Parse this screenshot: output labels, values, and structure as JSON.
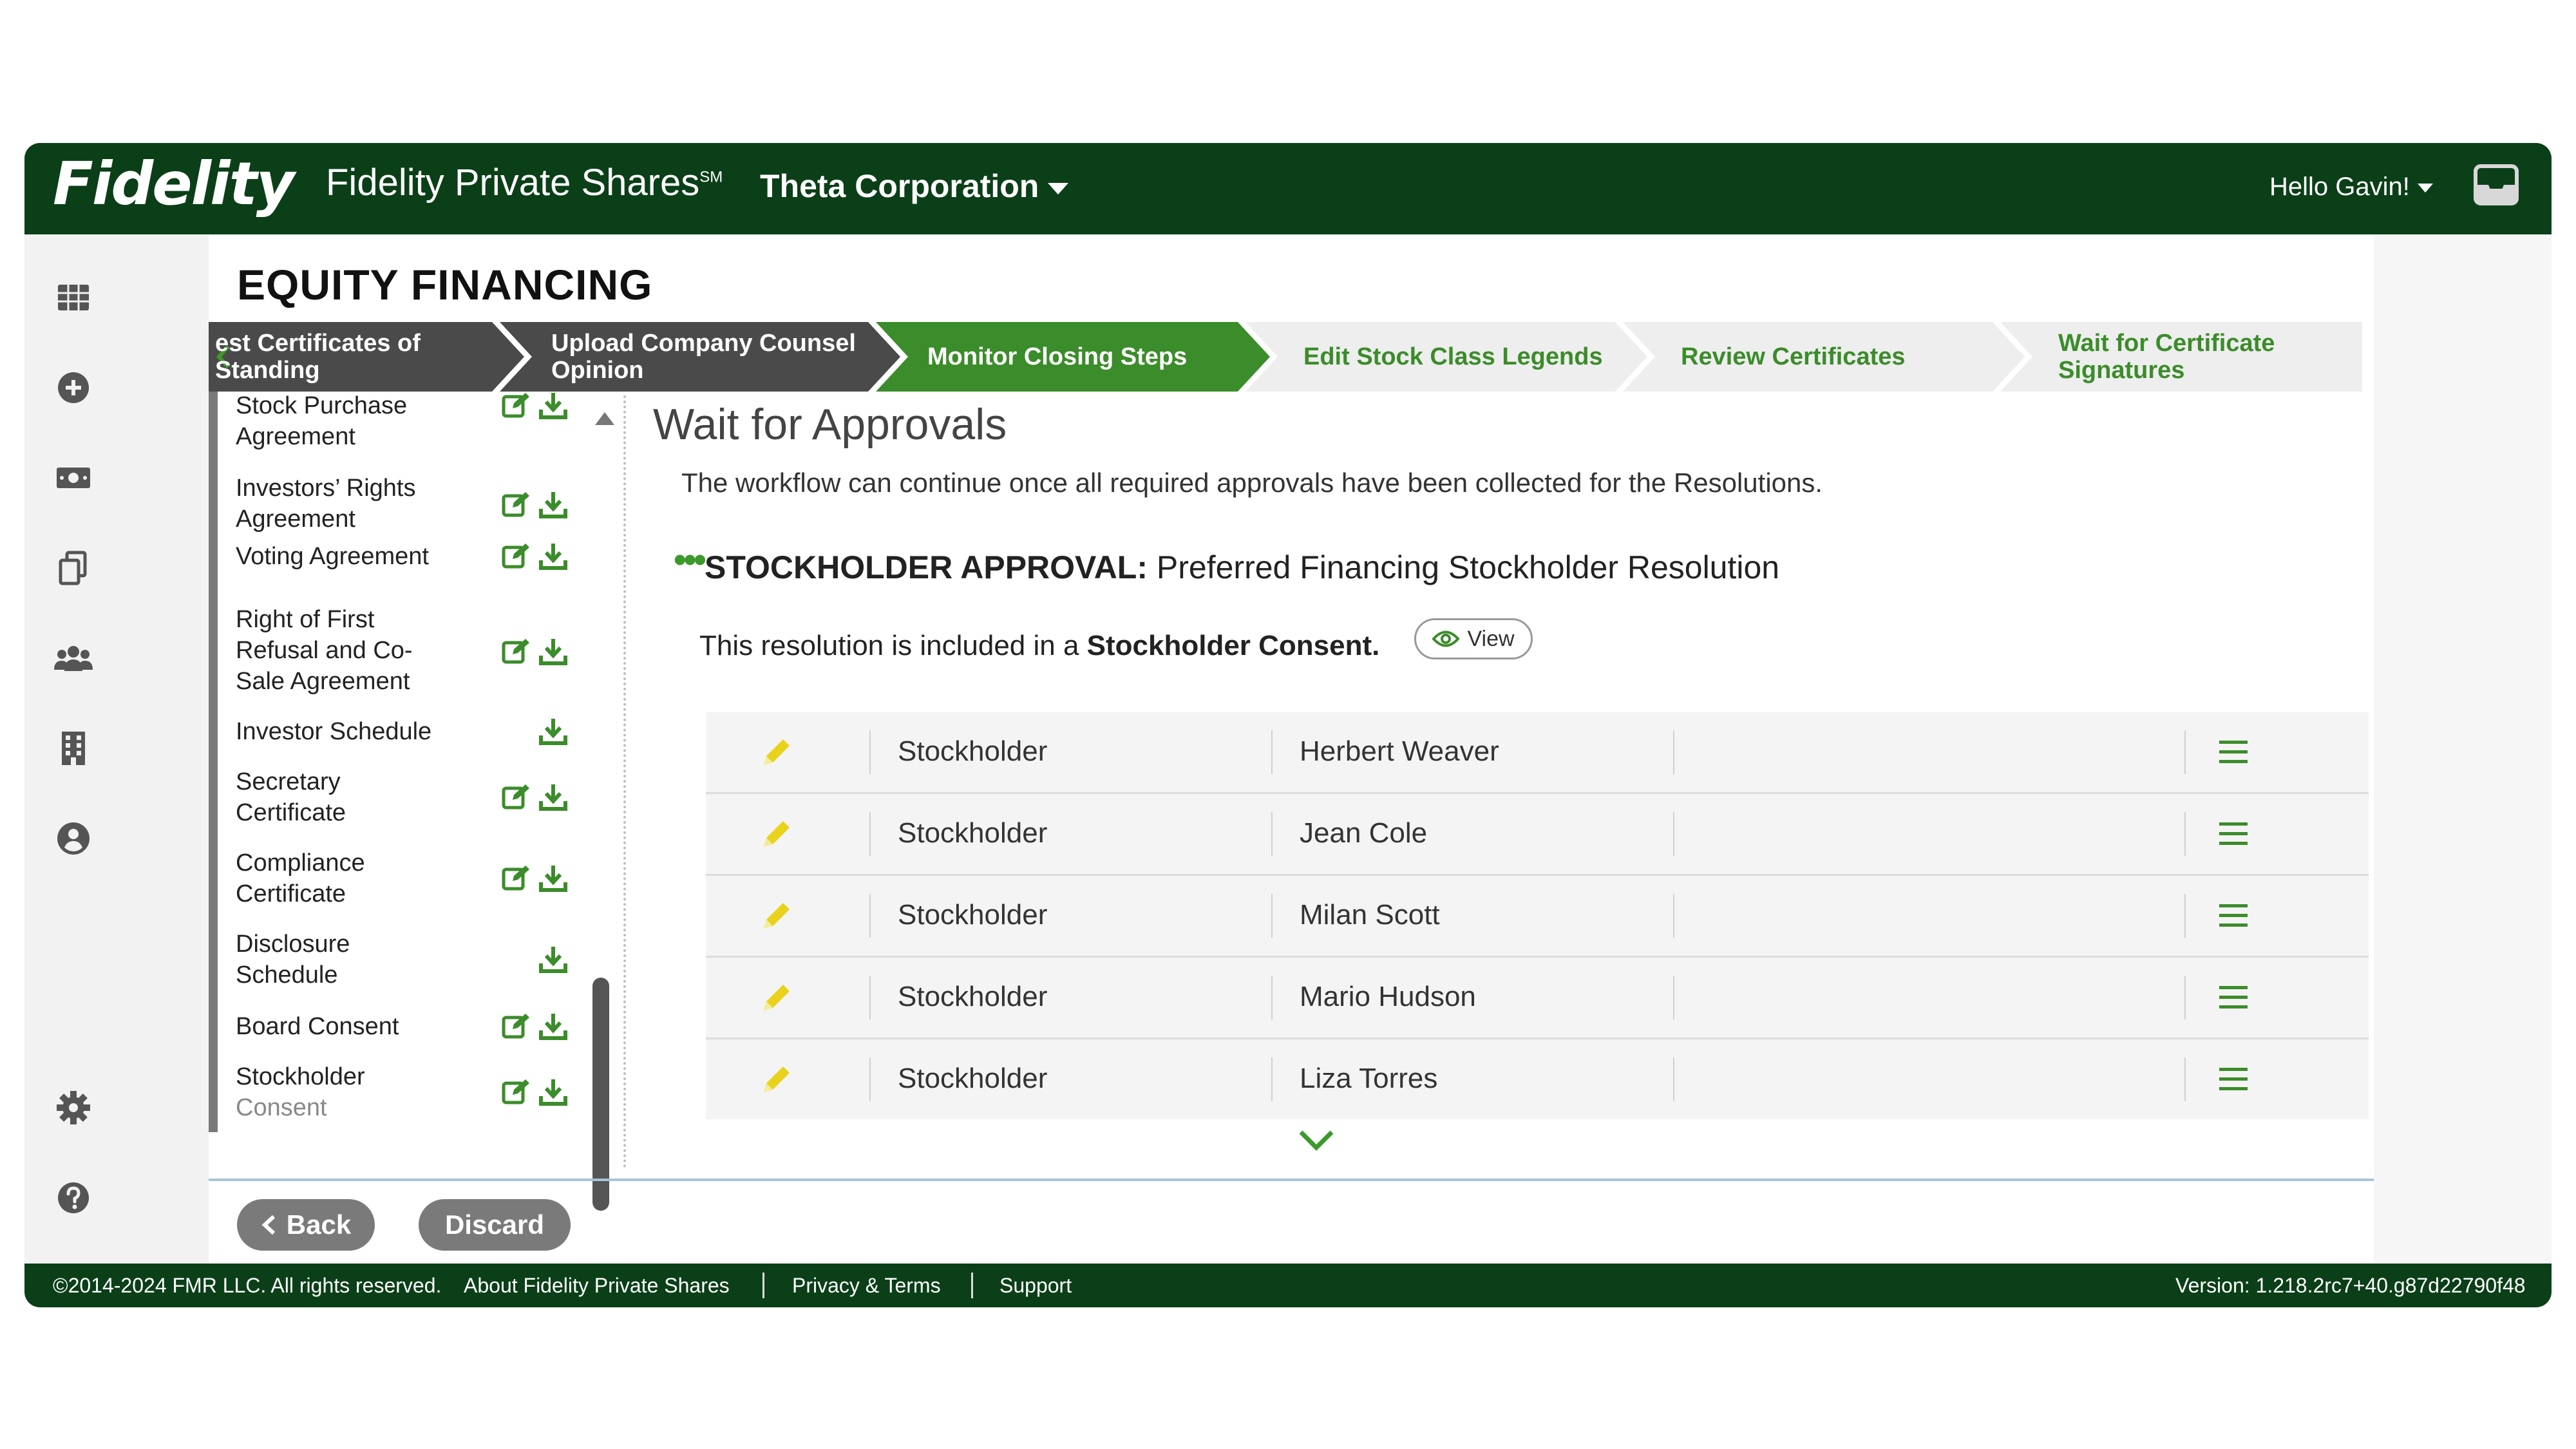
{
  "header": {
    "logo": "Fidelity",
    "product": "Fidelity Private Shares",
    "product_mark": "SM",
    "company": "Theta Corporation",
    "greeting": "Hello Gavin!"
  },
  "rail": {
    "icons": [
      "grid-icon",
      "plus-circle-icon",
      "money-icon",
      "copy-icon",
      "people-icon",
      "building-icon",
      "user-circle-icon",
      "gear-icon",
      "help-icon"
    ]
  },
  "page": {
    "title": "EQUITY FINANCING"
  },
  "steps": [
    {
      "line1": "est Certificates of",
      "line2": "Standing",
      "state": "done"
    },
    {
      "line1": "Upload Company Counsel",
      "line2": "Opinion",
      "state": "done"
    },
    {
      "line1": "Monitor Closing Steps",
      "line2": "",
      "state": "active"
    },
    {
      "line1": "Edit Stock Class Legends",
      "line2": "",
      "state": "pending"
    },
    {
      "line1": "Review Certificates",
      "line2": "",
      "state": "pending"
    },
    {
      "line1": "Wait for Certificate",
      "line2": "Signatures",
      "state": "pending"
    }
  ],
  "documents": [
    {
      "line1": "Stock Purchase",
      "line2": "Agreement"
    },
    {
      "line1": "Investors’ Rights",
      "line2": "Agreement"
    },
    {
      "line1": "Voting Agreement",
      "line2": ""
    },
    {
      "line1": "Right of First",
      "line2": "Refusal and Co-",
      "line3": "Sale Agreement"
    },
    {
      "line1": "Investor Schedule",
      "line2": ""
    },
    {
      "line1": "Secretary",
      "line2": "Certificate"
    },
    {
      "line1": "Compliance",
      "line2": "Certificate"
    },
    {
      "line1": "Disclosure",
      "line2": "Schedule"
    },
    {
      "line1": "Board Consent",
      "line2": ""
    },
    {
      "line1": "Stockholder",
      "line2": "Consent"
    }
  ],
  "approvals": {
    "title": "Wait for Approvals",
    "description": "The workflow can continue once all required approvals have been collected for the Resolutions.",
    "heading_bold": "STOCKHOLDER APPROVAL:",
    "heading_rest": "Preferred Financing Stockholder Resolution",
    "consent_prefix": "This resolution is included in a ",
    "consent_bold": "Stockholder Consent.",
    "view_label": "View",
    "rows": [
      {
        "role": "Stockholder",
        "name": "Herbert Weaver"
      },
      {
        "role": "Stockholder",
        "name": "Jean Cole"
      },
      {
        "role": "Stockholder",
        "name": "Milan Scott"
      },
      {
        "role": "Stockholder",
        "name": "Mario Hudson"
      },
      {
        "role": "Stockholder",
        "name": "Liza Torres"
      }
    ]
  },
  "actions": {
    "back_label": "Back",
    "discard_label": "Discard"
  },
  "footer": {
    "copyright": "©2014-2024 FMR LLC. All rights reserved.",
    "about": "About Fidelity Private Shares",
    "privacy": "Privacy & Terms",
    "support": "Support",
    "version": "Version: 1.218.2rc7+40.g87d22790f48"
  },
  "colors": {
    "brand_dark": "#0b3f18",
    "step_done": "#4a4a4a",
    "step_active": "#3b8c2a",
    "step_pending": "#eeeeee",
    "accent_green": "#3b9a2a",
    "pencil_yellow": "#e9d21b"
  }
}
